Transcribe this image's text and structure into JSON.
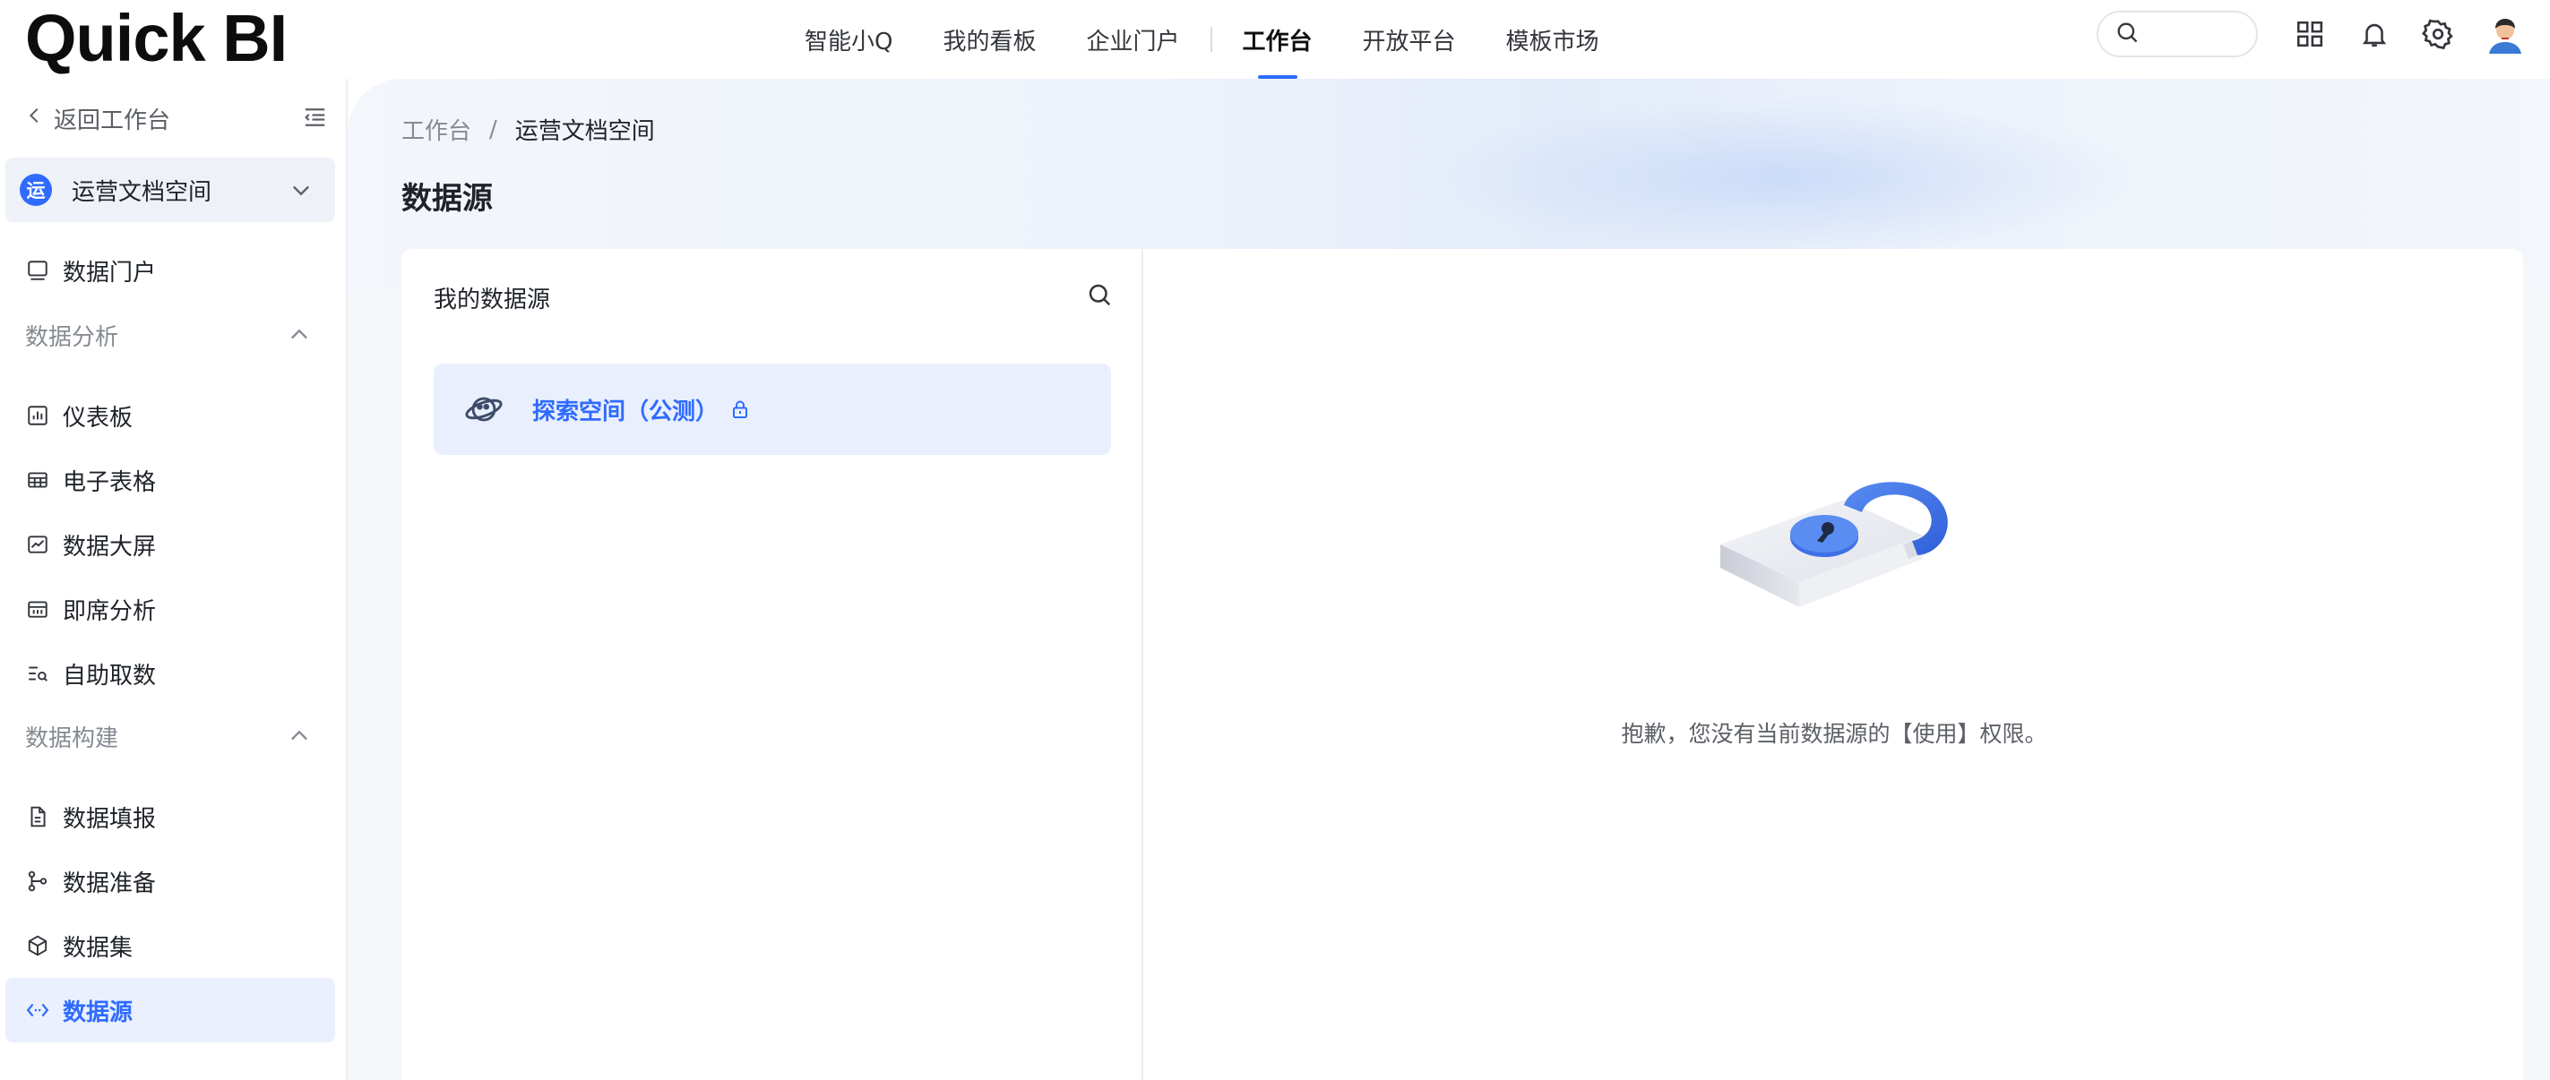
{
  "app": {
    "logo_text": "Quick BI"
  },
  "topnav": {
    "items": [
      {
        "label": "智能小Q"
      },
      {
        "label": "我的看板"
      },
      {
        "label": "企业门户"
      },
      {
        "label": "工作台"
      },
      {
        "label": "开放平台"
      },
      {
        "label": "模板市场"
      }
    ],
    "active": "工作台"
  },
  "topbar_icons": [
    "search-icon",
    "apps-grid-icon",
    "bell-icon",
    "gear-icon",
    "avatar"
  ],
  "sidebar": {
    "back_label": "返回工作台",
    "workspace": {
      "badge": "运",
      "name": "运营文档空间"
    },
    "items": {
      "portal": "数据门户",
      "group_analysis": "数据分析",
      "dashboard": "仪表板",
      "spreadsheet": "电子表格",
      "bigscreen": "数据大屏",
      "adhoc": "即席分析",
      "selfservice": "自助取数",
      "group_build": "数据构建",
      "fillin": "数据填报",
      "prep": "数据准备",
      "dataset": "数据集",
      "datasource": "数据源"
    },
    "active": "数据源"
  },
  "main": {
    "breadcrumb": {
      "root": "工作台",
      "sep": "/",
      "current": "运营文档空间"
    },
    "title": "数据源",
    "list": {
      "title": "我的数据源",
      "items": [
        {
          "name": "探索空间（公测）",
          "locked": true
        }
      ]
    },
    "empty_message": "抱歉，您没有当前数据源的【使用】权限。"
  },
  "colors": {
    "accent": "#2f6bff",
    "active_bg": "#eaf0fd"
  }
}
